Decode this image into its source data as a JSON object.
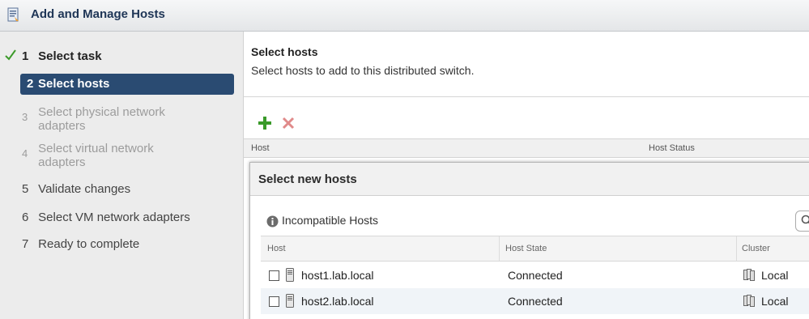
{
  "window": {
    "title": "Add and Manage Hosts"
  },
  "steps": [
    {
      "num": "1",
      "label": "Select task",
      "state": "done"
    },
    {
      "num": "2",
      "label": "Select hosts",
      "state": "active"
    },
    {
      "num": "3",
      "label": "Select physical network adapters",
      "state": "disabled"
    },
    {
      "num": "4",
      "label": "Select virtual network adapters",
      "state": "disabled"
    },
    {
      "num": "5",
      "label": "Validate changes",
      "state": "pending"
    },
    {
      "num": "6",
      "label": "Select VM network adapters",
      "state": "pending"
    },
    {
      "num": "7",
      "label": "Ready to complete",
      "state": "pending"
    }
  ],
  "main": {
    "title": "Select hosts",
    "description": "Select hosts to add to this distributed switch.",
    "columns": [
      "Host",
      "Host Status"
    ]
  },
  "dialog": {
    "title": "Select new hosts",
    "incompatible_label": "Incompatible Hosts",
    "columns": [
      "Host",
      "Host State",
      "Cluster"
    ],
    "rows": [
      {
        "host": "host1.lab.local",
        "state": "Connected",
        "cluster": "Local",
        "checked": false
      },
      {
        "host": "host2.lab.local",
        "state": "Connected",
        "cluster": "Local",
        "checked": false
      }
    ]
  },
  "colors": {
    "accent": "#2a4b72",
    "add": "#3a9a2a",
    "remove": "#e08a8a"
  }
}
